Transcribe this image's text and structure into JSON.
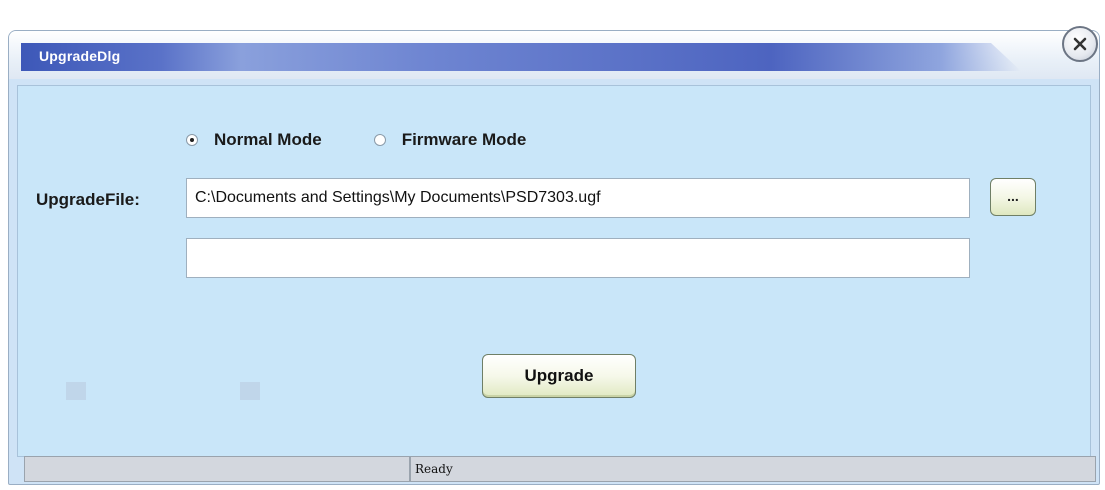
{
  "window": {
    "title": "UpgradeDlg"
  },
  "mode": {
    "options": [
      {
        "label": "Normal Mode",
        "selected": true
      },
      {
        "label": "Firmware Mode",
        "selected": false
      }
    ]
  },
  "upgrade_file": {
    "label": "UpgradeFile:",
    "value": "C:\\Documents and Settings\\My Documents\\PSD7303.ugf"
  },
  "browse": {
    "label": "..."
  },
  "progress_field": {
    "value": ""
  },
  "actions": {
    "upgrade_label": "Upgrade"
  },
  "status_bar": {
    "left_text": "",
    "right_text": "Ready"
  },
  "colors": {
    "client_bg": "#c9e6f9",
    "title_band": "#4d64c0",
    "button_bg": "#e0e9c2"
  }
}
